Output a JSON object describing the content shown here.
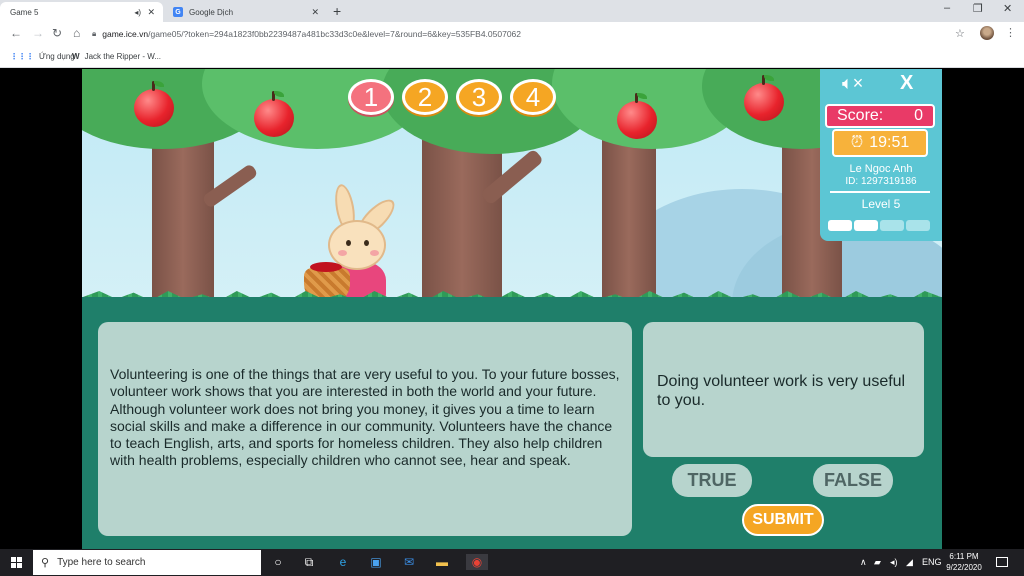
{
  "browser": {
    "tabs": [
      {
        "label": "Game 5",
        "active": true
      },
      {
        "label": "Google Dịch",
        "active": false
      }
    ],
    "url": {
      "host": "game.ice.vn",
      "path": "/game05/?token=294a1823f0bb2239487a481bc33d3c0e&level=7&round=6&key=535FB4.0507062"
    },
    "bookmarks": [
      {
        "label": "Ứng dụng",
        "icon": "apps-grid-icon"
      },
      {
        "label": "Jack the Ripper - W...",
        "icon": "wikipedia-icon"
      }
    ]
  },
  "game": {
    "question_numbers": [
      "1",
      "2",
      "3",
      "4"
    ],
    "current_question": 1,
    "score_label": "Score:",
    "score_value": "0",
    "timer": "19:51",
    "user_name": "Le Ngoc Anh",
    "user_id": "ID: 1297319186",
    "level": "Level 5",
    "level_progress": {
      "filled": 2,
      "total": 4
    },
    "passage": "Volunteering is one of the things that are very useful to you. To your future bosses, volunteer work shows that you are interested in both the world and your future. Although volunteer work does not bring you money, it gives you a time to learn social skills and make a difference in our community. Volunteers have the chance to teach English, arts, and sports for homeless children. They also help children with health problems, especially children who cannot see, hear and speak.",
    "statement": "Doing volunteer work is very useful to you.",
    "true_label": "TRUE",
    "false_label": "FALSE",
    "submit_label": "SUBMIT",
    "colors": {
      "panel": "#5cc6d4",
      "score_bg": "#e93a67",
      "timer_bg": "#f7b23b",
      "bubble": "#f5a623",
      "bubble_current": "#f4727e",
      "card": "#b7d4cd",
      "ground": "#1f7f6a"
    }
  },
  "taskbar": {
    "search_placeholder": "Type here to search",
    "language": "ENG",
    "time": "6:11 PM",
    "date": "9/22/2020"
  }
}
